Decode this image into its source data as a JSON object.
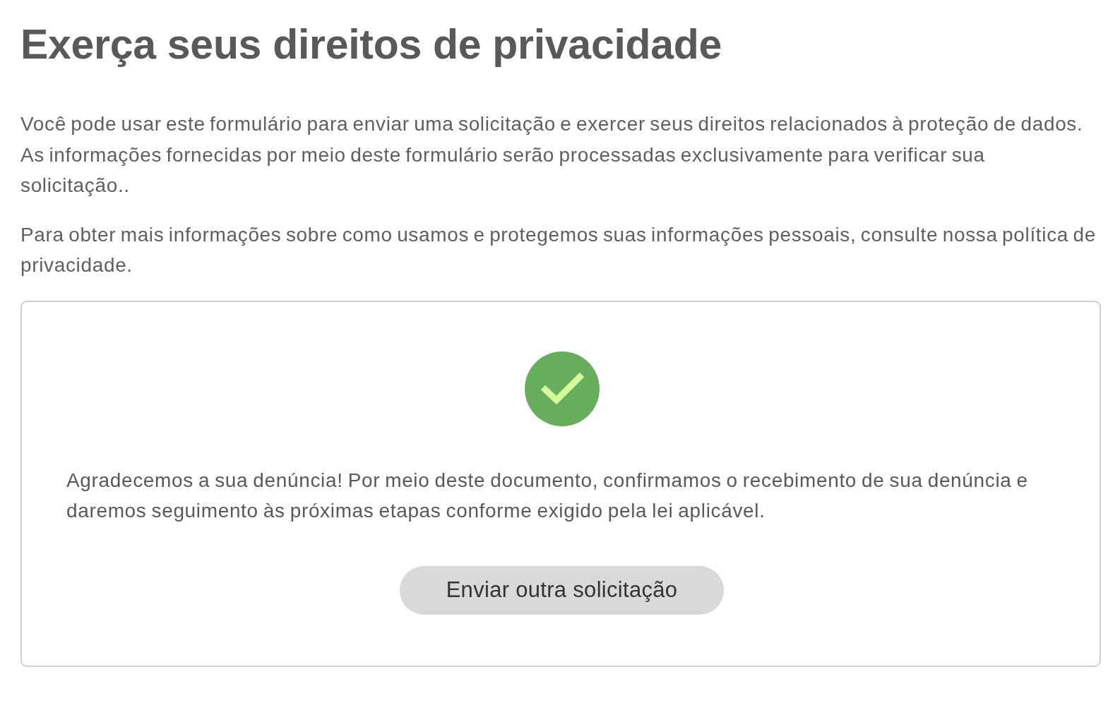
{
  "heading": "Exerça seus direitos de privacidade",
  "paragraphs": [
    "Você pode usar este formulário para enviar uma solicitação e exercer seus direitos relacionados à proteção de dados. As informações fornecidas por meio deste formulário serão processadas exclusivamente para verificar sua solicitação..",
    "Para obter mais informações sobre como usamos e protegemos suas informações pessoais, consulte nossa política de privacidade."
  ],
  "confirmation": {
    "kind": "success",
    "message": "Agradecemos a sua denúncia! Por meio deste documento, confirmamos o recebimento de sua denúncia e daremos seguimento às próximas etapas conforme exigido pela lei aplicável.",
    "button": "Enviar outra solicitação"
  }
}
